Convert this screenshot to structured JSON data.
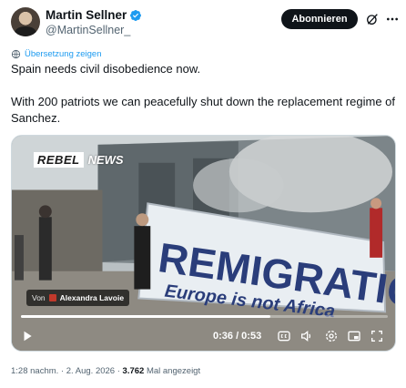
{
  "author": {
    "name": "Martin Sellner",
    "handle": "@MartinSellner_",
    "verified_icon": "verified-badge-icon",
    "accent": "#1d9bf0"
  },
  "header": {
    "follow_label": "Abonnieren",
    "grok_icon": "grok-icon",
    "more_icon": "more-icon"
  },
  "translate": {
    "label": "Übersetzung zeigen",
    "icon": "translate-icon"
  },
  "tweet": {
    "line1": "Spain needs civil disobedience now.",
    "line2": "With 200 patriots we can peacefully shut down the replacement regime of Sanchez."
  },
  "video": {
    "brand_part1": "REBEL",
    "brand_part2": "NEWS",
    "banner_text1": "REMIGRATION",
    "banner_text2": "Europe is not Africa",
    "credit_from": "Von",
    "credit_name": "Alexandra Lavoie",
    "time": "0:36 / 0:53",
    "progress_fraction": 0.68,
    "controls": [
      "play-icon",
      "captions-icon",
      "volume-icon",
      "settings-icon",
      "pip-icon",
      "fullscreen-icon"
    ]
  },
  "meta": {
    "timestamp": "1:28 nachm. · 2. Aug. 2026 · ",
    "views": "3.762",
    "views_label": " Mal angezeigt"
  }
}
